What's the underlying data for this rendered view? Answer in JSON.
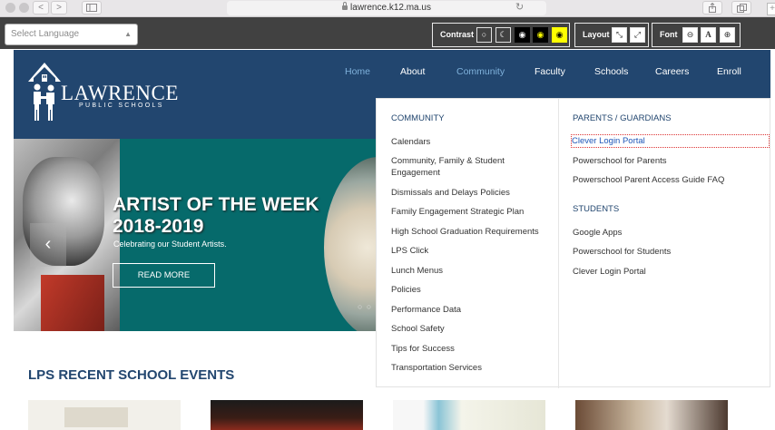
{
  "browser": {
    "url": "lawrence.k12.ma.us",
    "back_glyph": "<",
    "forward_glyph": ">",
    "reload_glyph": "↻",
    "new_tab_glyph": "+",
    "icons": [
      "lock-icon",
      "sidebar-icon",
      "share-icon",
      "tabs-icon",
      "reload-icon"
    ]
  },
  "toolbar": {
    "language_placeholder": "Select Language",
    "contrast_label": "Contrast",
    "layout_label": "Layout",
    "font_label": "Font",
    "font_reset_glyph": "A"
  },
  "header": {
    "logo_text": "LAWRENCE",
    "logo_subtext": "PUBLIC SCHOOLS",
    "nav": [
      "Home",
      "About",
      "Community",
      "Faculty",
      "Schools",
      "Careers",
      "Enroll"
    ]
  },
  "hero": {
    "title_line1": "ARTIST OF THE WEEK",
    "title_line2": "2018-2019",
    "subtitle": "Celebrating our Student Artists.",
    "button": "READ MORE",
    "prev_glyph": "‹"
  },
  "mega_menu": {
    "community_heading": "COMMUNITY",
    "community_links": [
      "Calendars",
      "Community, Family & Student",
      "Engagement",
      "Dismissals and Delays Policies",
      "Family Engagement Strategic Plan",
      "High School Graduation Requirements",
      "LPS Click",
      "Lunch Menus",
      "Policies",
      "Performance Data",
      "School Safety",
      "Tips for Success",
      "Transportation Services"
    ],
    "parents_heading": "PARENTS / GUARDIANS",
    "parents_links": [
      "Clever Login Portal",
      "Powerschool for Parents",
      "Powerschool Parent Access Guide FAQ"
    ],
    "students_heading": "STUDENTS",
    "students_links": [
      "Google Apps",
      "Powerschool for Students",
      "Clever Login Portal"
    ]
  },
  "events": {
    "title": "LPS RECENT SCHOOL EVENTS"
  },
  "colors": {
    "navy": "#22466f",
    "teal": "#066a6b",
    "toolbar": "#414141",
    "highlight": "#ffff00"
  }
}
